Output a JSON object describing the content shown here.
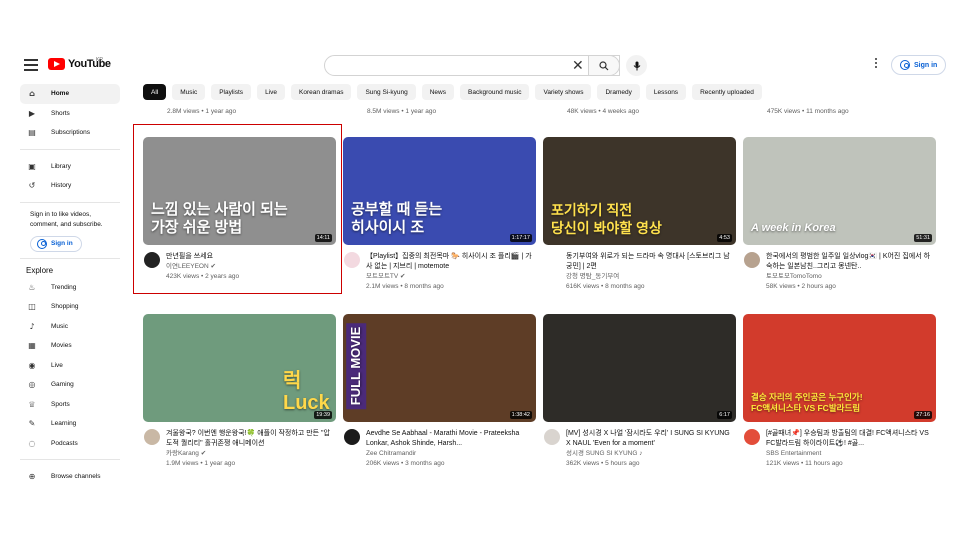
{
  "header": {
    "logo_text": "YouTube",
    "country_code": "KR",
    "search_value": "",
    "signin": "Sign in"
  },
  "chips": [
    "All",
    "Music",
    "Playlists",
    "Live",
    "Korean dramas",
    "Sung Si-kyung",
    "News",
    "Background music",
    "Variety shows",
    "Dramedy",
    "Lessons",
    "Recently uploaded"
  ],
  "sidebar": {
    "main": [
      {
        "label": "Home",
        "icon": "home-icon"
      },
      {
        "label": "Shorts",
        "icon": "shorts-icon"
      },
      {
        "label": "Subscriptions",
        "icon": "subscriptions-icon"
      }
    ],
    "library": [
      {
        "label": "Library",
        "icon": "library-icon"
      },
      {
        "label": "History",
        "icon": "history-icon"
      }
    ],
    "signin_note": "Sign in to like videos, comment, and subscribe.",
    "signin": "Sign in",
    "explore_title": "Explore",
    "explore": [
      {
        "label": "Trending",
        "icon": "trending-icon"
      },
      {
        "label": "Shopping",
        "icon": "shopping-icon"
      },
      {
        "label": "Music",
        "icon": "music-icon"
      },
      {
        "label": "Movies",
        "icon": "movies-icon"
      },
      {
        "label": "Live",
        "icon": "live-icon"
      },
      {
        "label": "Gaming",
        "icon": "gaming-icon"
      },
      {
        "label": "Sports",
        "icon": "sports-icon"
      },
      {
        "label": "Learning",
        "icon": "learning-icon"
      },
      {
        "label": "Podcasts",
        "icon": "podcasts-icon"
      }
    ],
    "browse": {
      "label": "Browse channels",
      "icon": "add-circle-icon"
    }
  },
  "prev_row": [
    "2.8M views • 1 year ago",
    "8.5M views • 1 year ago",
    "48K views • 4 weeks ago",
    "475K views • 11 months ago"
  ],
  "videos": [
    {
      "title": "만년필을 쓰세요",
      "channel": "이연LEEYEON ✔",
      "stats": "423K views • 2 years ago",
      "duration": "14:11",
      "thumb_text": "느낌 있는 사람이 되는\n가장 쉬운 방법",
      "thumb_bg": "#8f8f8f",
      "avatar_color": "#222222"
    },
    {
      "title": "【Playlist】집중의 최전목마 🐎 히사이시 조 플리🎬 | 가사 없는 | 지브리 | motemote",
      "channel": "모트모트TV ✔",
      "stats": "2.1M views • 8 months ago",
      "duration": "1:17:17",
      "thumb_text": "공부할 때 듣는\n히사이시 조",
      "thumb_bg": "#3a4bb0",
      "avatar_color": "#f3d9e0"
    },
    {
      "title": "동기부여와 위로가 되는 드라마 속 명대사 [스토브리그 남궁민] | 2편",
      "channel": "강청 명탐_동기부여",
      "stats": "616K views • 8 months ago",
      "duration": "4:53",
      "thumb_text": "포기하기 직전\n당신이 봐야할 영상",
      "thumb_bg": "#3d3429",
      "avatar_color": "#ffffff"
    },
    {
      "title": "한국에서의 평범한 일주일 일상vlog🇰🇷 | K어진 집에서 하숙하는 일본남친..그리고 몽넨탄..",
      "channel": "토모토모TomoTomo",
      "stats": "58K views • 2 hours ago",
      "duration": "51:31",
      "thumb_text": "A week in Korea",
      "thumb_bg": "#bfc3bb",
      "avatar_color": "#b7a28f"
    },
    {
      "title": "겨울왕국? 이번엔 행운왕국!🍀 애플이 작정하고 만든 \"압도적 퀄리티\" 홀귀존쟁 애니메이션",
      "channel": "카랑Karang ✔",
      "stats": "1.9M views • 1 year ago",
      "duration": "19:39",
      "thumb_text": "럭\nLuck",
      "thumb_bg": "#6f9b7d",
      "avatar_color": "#c9b8a5"
    },
    {
      "title": "Aevdhe Se Aabhaal - Marathi Movie - Prateeksha Lonkar, Ashok Shinde, Harsh...",
      "channel": "Zee Chitramandir",
      "stats": "206K views • 3 months ago",
      "duration": "1:38:42",
      "thumb_text": "FULL MOVIE",
      "thumb_bg": "#5e3d26",
      "avatar_color": "#1b1b1b"
    },
    {
      "title": "[MV] 성시경 X 나얼 '잠시라도 우리' I SUNG SI KYUNG X NAUL 'Even for a moment'",
      "channel": "성시경 SUNG SI KYUNG ♪",
      "stats": "362K views • 5 hours ago",
      "duration": "6:17",
      "thumb_text": "",
      "thumb_bg": "#2e2c28",
      "avatar_color": "#d9d4cf"
    },
    {
      "title": "[#골때녀📌] 우승팀과 방출팀의 대결! FC액셔니스타 VS FC발라드림 하이라이트⚽! #골...",
      "channel": "SBS Entertainment",
      "stats": "121K views • 11 hours ago",
      "duration": "27:16",
      "thumb_text": "결승 자리의 주인공은 누구인가!\nFC액셔니스타 VS FC발라드림",
      "thumb_bg": "#d23b2c",
      "avatar_color": "#e34d3a"
    }
  ]
}
